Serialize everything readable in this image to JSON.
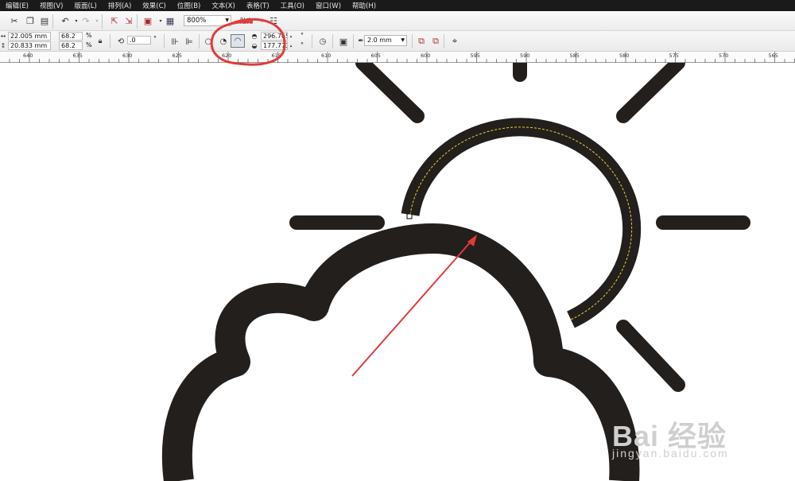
{
  "menu": [
    "编辑(E)",
    "视图(V)",
    "版面(L)",
    "排列(A)",
    "效果(C)",
    "位图(B)",
    "文本(X)",
    "表格(T)",
    "工具(O)",
    "窗口(W)",
    "帮助(H)"
  ],
  "toolbar": {
    "zoom": "800%",
    "snap_label": "贴齐"
  },
  "property_bar": {
    "width": "22.005 mm",
    "height": "20.833 mm",
    "scale_x": "68.2",
    "scale_y": "68.2",
    "percent": "%",
    "rotation": ".0",
    "degree": "°",
    "start_angle": "296.765",
    "end_angle": "177.773",
    "outline_width": "2.0 mm"
  },
  "ruler": {
    "labels": [
      "640",
      "635",
      "630",
      "625",
      "620",
      "615",
      "610",
      "605",
      "600",
      "595",
      "590",
      "585",
      "580",
      "575",
      "570",
      "565"
    ]
  },
  "watermark": {
    "logo": "Bai 经验",
    "url": "jingyan.baidu.com"
  },
  "colors": {
    "menubar": "#1a1a1a",
    "shape": "#231f1c",
    "annotation": "#e23a3a",
    "selection_dash": "#e6d23a"
  }
}
